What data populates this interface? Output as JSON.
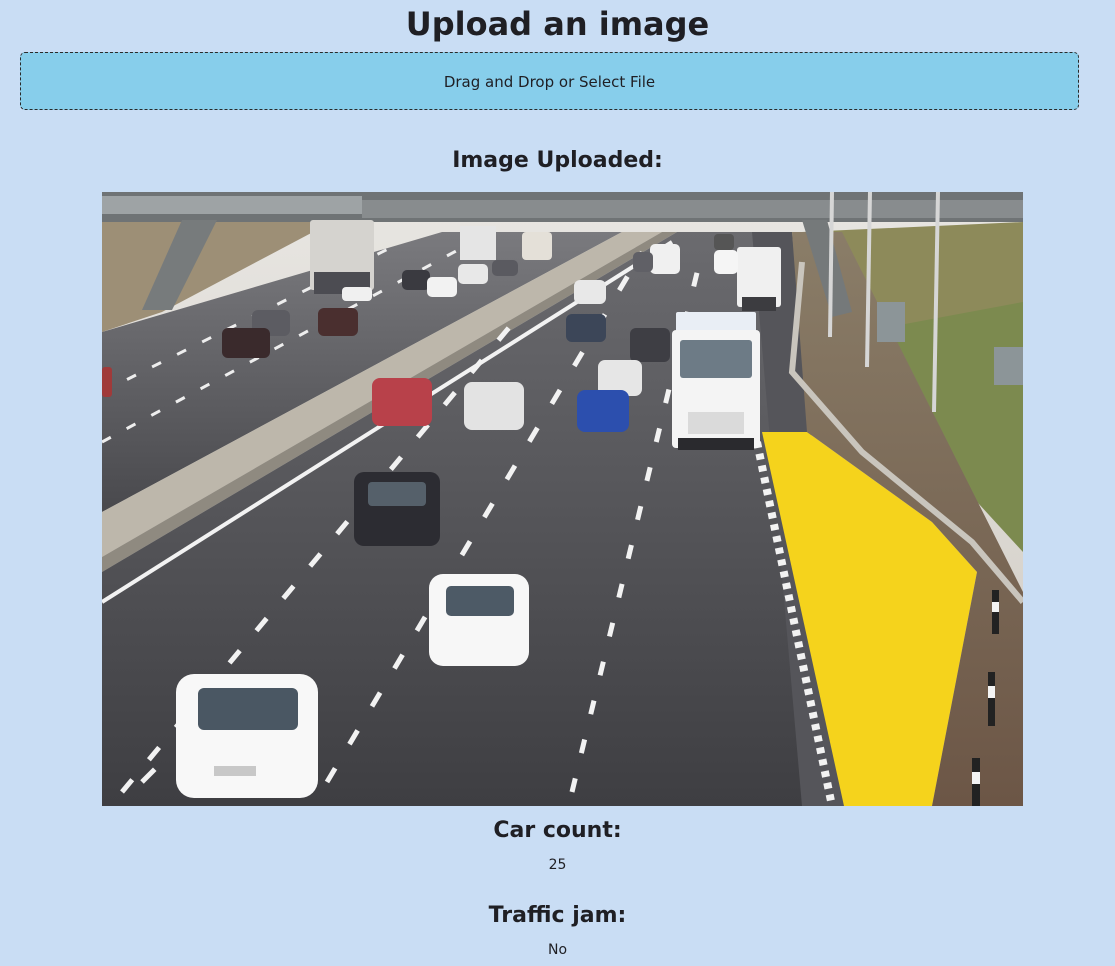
{
  "upload": {
    "title": "Upload an image",
    "dropzone_label": "Drag and Drop or Select File"
  },
  "uploaded": {
    "heading": "Image Uploaded:",
    "image": "highway-traffic-photo"
  },
  "results": {
    "car_count_label": "Car count:",
    "car_count_value": "25",
    "traffic_jam_label": "Traffic jam:",
    "traffic_jam_value": "No"
  },
  "colors": {
    "background": "#c9ddf4",
    "dropzone": "#87ceeb",
    "emergency_area": "#f5d31c"
  }
}
